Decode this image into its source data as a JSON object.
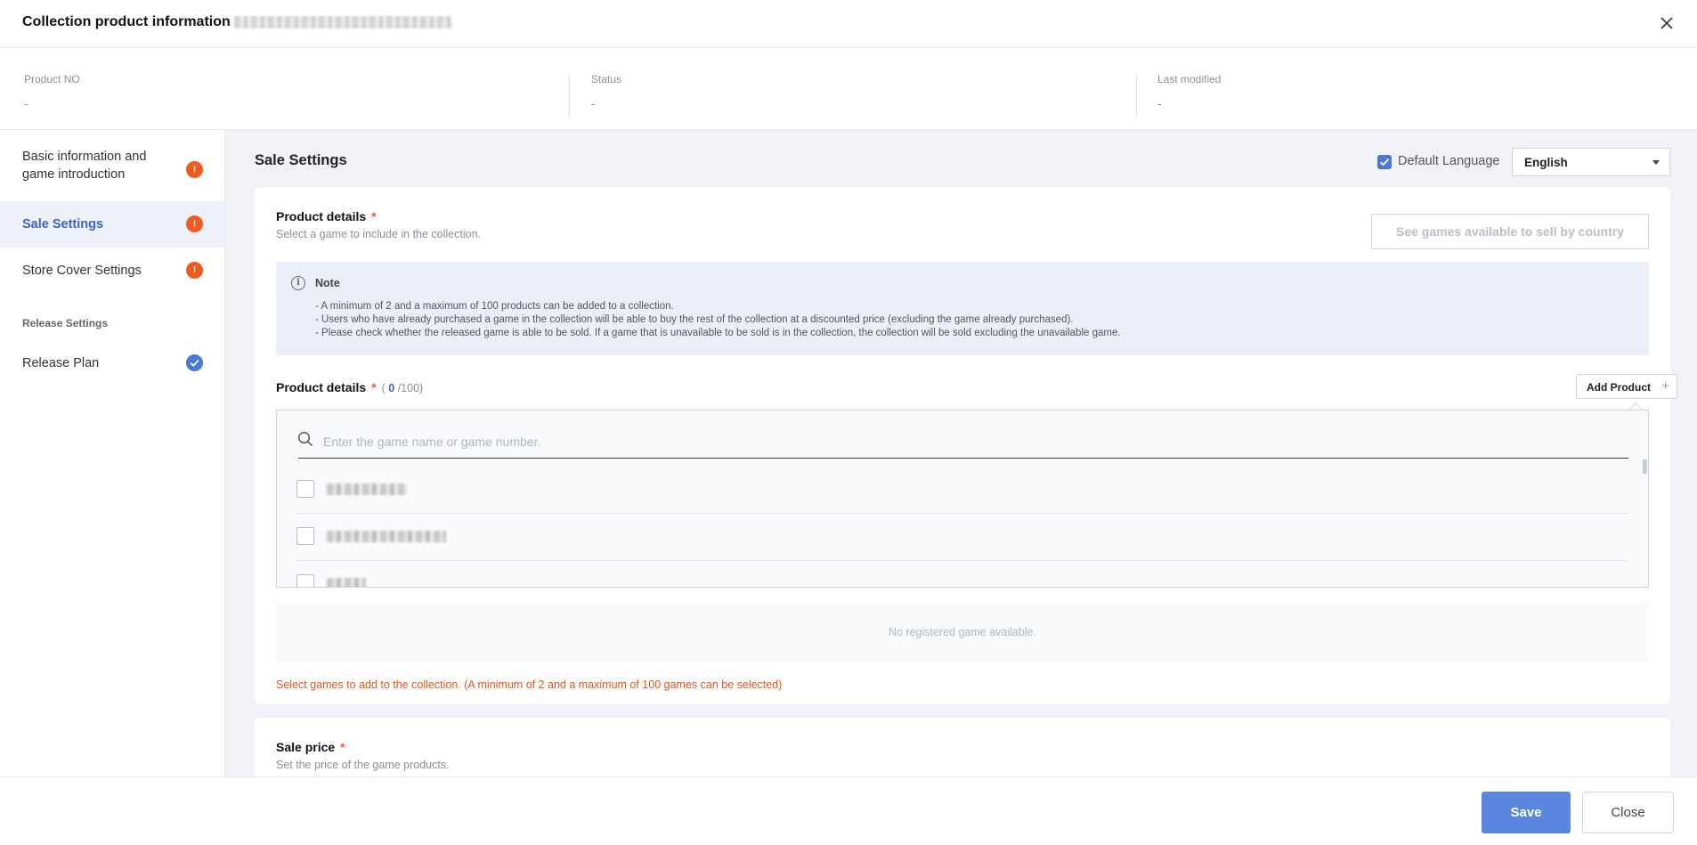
{
  "header": {
    "title": "Collection product information",
    "close_icon": "close-icon"
  },
  "info": {
    "product_no_label": "Product NO",
    "product_no_value": "-",
    "status_label": "Status",
    "status_value": "-",
    "last_modified_label": "Last modified",
    "last_modified_value": "-"
  },
  "sidebar": {
    "items": [
      {
        "label_line1": "Basic information and",
        "label_line2": "game introduction",
        "badge": "!",
        "state": "warning"
      },
      {
        "label": "Sale Settings",
        "badge": "!",
        "state": "warning",
        "active": true
      },
      {
        "label": "Store Cover Settings",
        "badge": "!",
        "state": "warning"
      }
    ],
    "section_title": "Release Settings",
    "release_plan": {
      "label": "Release Plan",
      "state": "complete"
    }
  },
  "main": {
    "title": "Sale Settings",
    "default_language_label": "Default Language",
    "default_language_checked": true,
    "language_value": "English"
  },
  "product_details": {
    "title": "Product details",
    "required_mark": "*",
    "subtitle": "Select a game to include in the collection.",
    "see_games_button": "See games available to sell by country",
    "note": {
      "title": "Note",
      "icon_glyph": "i",
      "lines": [
        "- A minimum of 2 and a maximum of 100 products can be added to a collection.",
        "- Users who have already purchased a game in the collection will be able to buy the rest of the collection at a discounted price (excluding the game already purchased).",
        "- Please check whether the released game is able to be sold. If a game that is unavailable to be sold is in the collection, the collection will be sold excluding the unavailable game."
      ]
    },
    "list_title": "Product details",
    "count_open": "(",
    "count_selected": "0",
    "count_max": "/100)",
    "add_product_button": "Add Product",
    "add_icon_glyph": "+",
    "search_placeholder": "Enter the game name or game number.",
    "options_count_visible": 3,
    "empty_message": "No registered game available.",
    "error_message": "Select games to add to the collection. (A minimum of 2 and a maximum of 100 games can be selected)"
  },
  "sale_price": {
    "title": "Sale price",
    "required_mark": "*",
    "subtitle": "Set the price of the game products."
  },
  "footer": {
    "save_label": "Save",
    "close_label": "Close"
  },
  "colors": {
    "accent": "#4a78d9",
    "warning": "#f05a1f",
    "error": "#e0561c"
  }
}
